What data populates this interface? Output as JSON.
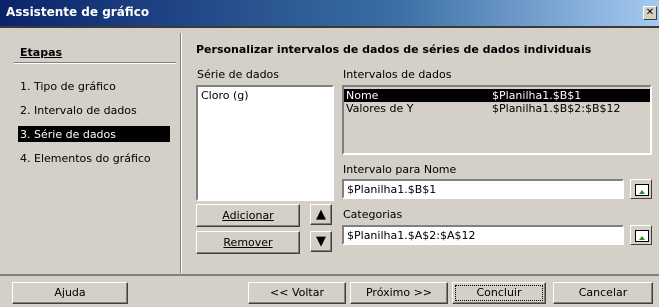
{
  "window": {
    "title": "Assistente de gráfico",
    "close_glyph": "✕"
  },
  "steps": {
    "title": "Etapas",
    "items": [
      {
        "label": "1. Tipo de gráfico",
        "selected": false
      },
      {
        "label": "2. Intervalo de dados",
        "selected": false
      },
      {
        "label": "3. Série de dados",
        "selected": true
      },
      {
        "label": "4. Elementos do gráfico",
        "selected": false
      }
    ]
  },
  "main": {
    "title": "Personalizar intervalos de dados de séries de dados individuais",
    "series_label": "Série de dados",
    "series_items": [
      "Cloro (g)"
    ],
    "ranges_label": "Intervalos de dados",
    "ranges": [
      {
        "name": "Nome",
        "value": "$Planilha1.$B$1",
        "selected": true
      },
      {
        "name": "Valores de Y",
        "value": "$Planilha1.$B$2:$B$12",
        "selected": false
      }
    ],
    "range_for_name_label": "Intervalo para Nome",
    "range_for_name_value": "$Planilha1.$B$1",
    "categories_label": "Categorias",
    "categories_value": "$Planilha1.$A$2:$A$12",
    "add_button": "Adicionar",
    "remove_button": "Remover",
    "up_glyph": "▲",
    "down_glyph": "▼"
  },
  "footer": {
    "help": "Ajuda",
    "back": "<< Voltar",
    "next": "Próximo >>",
    "finish": "Concluir",
    "cancel": "Cancelar"
  }
}
